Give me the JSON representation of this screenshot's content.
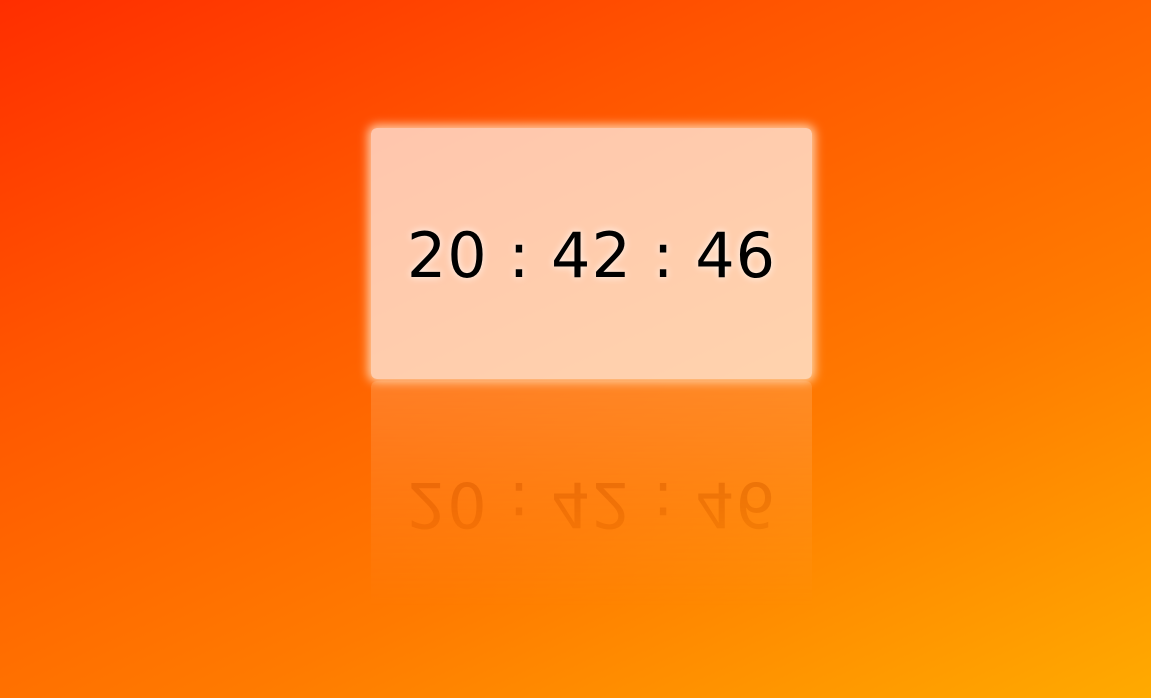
{
  "clock": {
    "time": "20 : 42 : 46",
    "hours": "20",
    "minutes": "42",
    "seconds": "46"
  },
  "colors": {
    "background_start": "#ff2e00",
    "background_end": "#ffaa00",
    "card": "#ffd0b8"
  }
}
